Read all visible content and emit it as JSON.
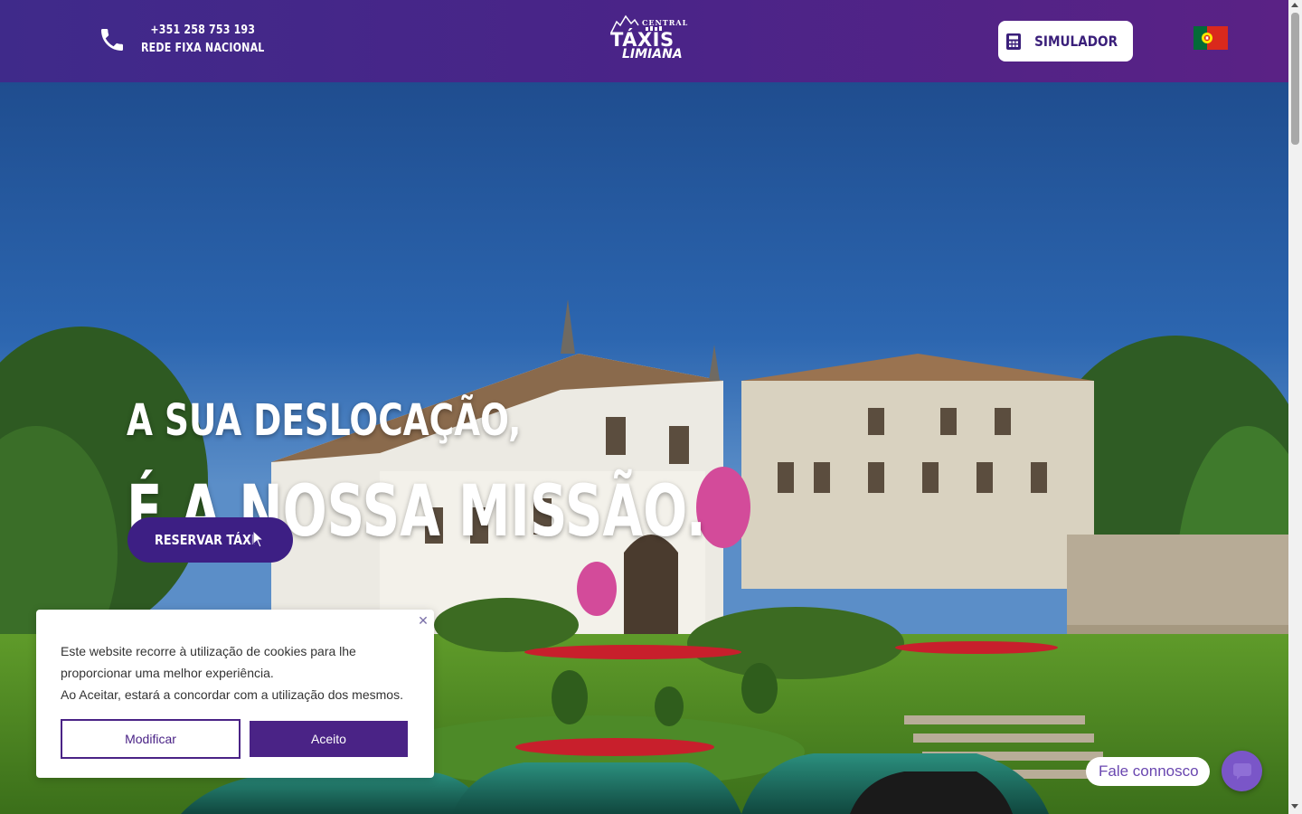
{
  "header": {
    "phone_number": "+351 258 753 193",
    "phone_caption": "REDE FIXA NACIONAL",
    "logo": {
      "top": "CENTRAL",
      "main": "TÁXIS",
      "bottom": "LIMIANA"
    },
    "simulator_label": "SIMULADOR",
    "language_flag": "portugal-flag"
  },
  "hero": {
    "title_line1": "A SUA DESLOCAÇÃO,",
    "title_line2": "É A NOSSA MISSÃO.",
    "reserve_label": "RESERVAR TÁXI"
  },
  "cookie_banner": {
    "close_symbol": "✕",
    "text_line1": "Este website recorre à utilização de cookies para lhe proporcionar uma melhor experiência.",
    "text_line2": "Ao Aceitar, estará a concordar com a utilização dos mesmos.",
    "modify_label": "Modificar",
    "accept_label": "Aceito"
  },
  "contact_widget": {
    "label": "Fale connosco"
  },
  "colors": {
    "brand_purple": "#4a2386",
    "header_gradient_start": "#3f2a8a",
    "header_gradient_end": "#5a2285",
    "chat_button": "#7a56c8"
  }
}
